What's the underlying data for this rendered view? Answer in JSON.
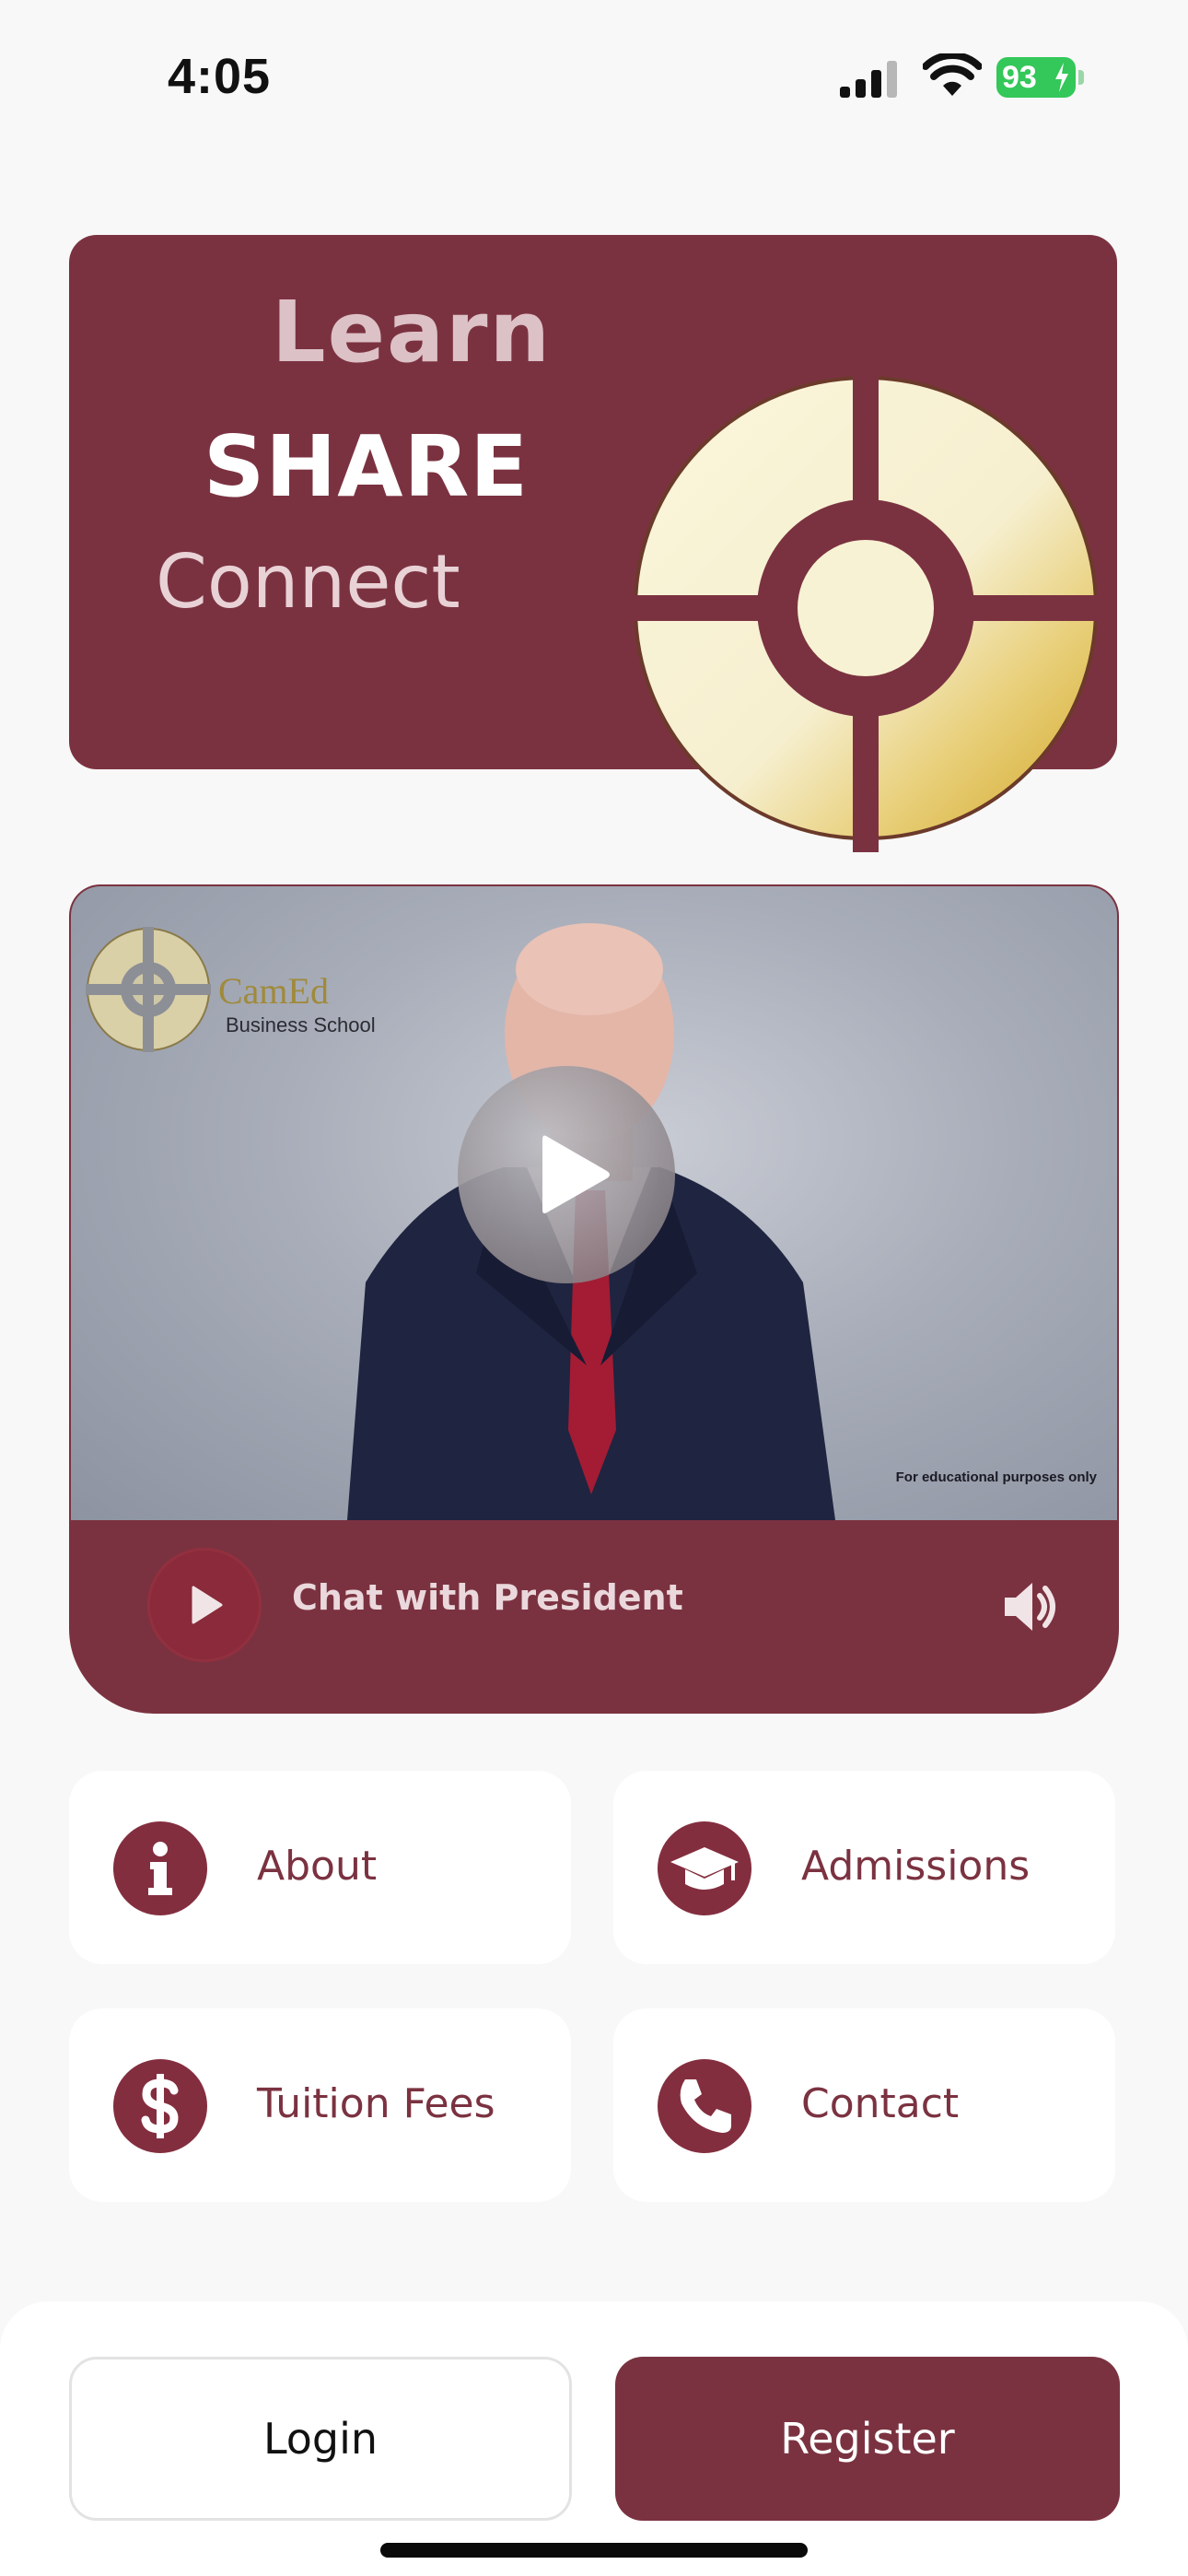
{
  "status_bar": {
    "time": "4:05",
    "battery": "93",
    "battery_color": "#34c759",
    "icons": [
      "signal-icon",
      "wifi-icon",
      "battery-icon",
      "charging-bolt-icon"
    ]
  },
  "banner": {
    "line1": "Learn",
    "line2": "SHARE",
    "line3": "Connect",
    "background": "#7b3240"
  },
  "video": {
    "school_name_top": "CamEd",
    "school_name_bottom": "Business School",
    "watermark": "For educational purposes only",
    "player_title": "Chat with President",
    "icons": [
      "play-icon",
      "volume-icon"
    ]
  },
  "menu": {
    "items": [
      {
        "label": "About",
        "icon": "info-icon"
      },
      {
        "label": "Admissions",
        "icon": "graduation-cap-icon"
      },
      {
        "label": "Tuition Fees",
        "icon": "dollar-icon"
      },
      {
        "label": "Contact",
        "icon": "phone-icon"
      }
    ]
  },
  "auth": {
    "login_label": "Login",
    "register_label": "Register"
  },
  "colors": {
    "brand": "#7b3240",
    "icon_bg": "#832e3f",
    "page_bg": "#f8f8f8"
  }
}
